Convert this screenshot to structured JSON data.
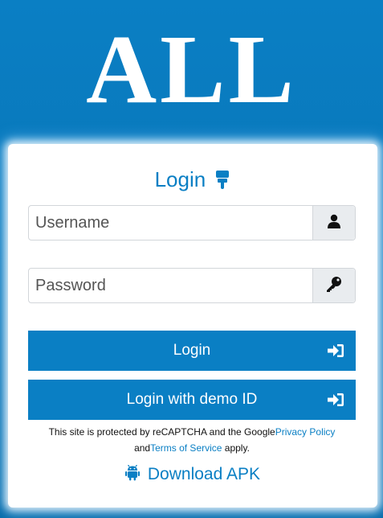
{
  "logo_text": "ALL",
  "login_title": "Login",
  "username": {
    "placeholder": "Username",
    "value": ""
  },
  "password": {
    "placeholder": "Password",
    "value": ""
  },
  "buttons": {
    "login": "Login",
    "demo": "Login with demo ID"
  },
  "notice": {
    "prefix": "This site is protected by reCAPTCHA and the Google",
    "privacy": "Privacy Policy",
    "and": " and",
    "terms": "Terms of Service",
    "suffix": " apply."
  },
  "download_label": "Download APK",
  "icons": {
    "title": "hand-point-down-icon",
    "username": "user-icon",
    "password": "key-icon",
    "login": "sign-in-icon",
    "demo": "sign-in-icon",
    "download": "android-icon"
  },
  "colors": {
    "accent": "#0a7fc4",
    "background": "#0874b6",
    "addon": "#e9ecef"
  }
}
